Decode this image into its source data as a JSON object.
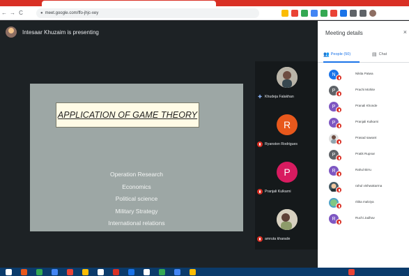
{
  "browser": {
    "url": "meet.google.com/ffo-jhjc-xey",
    "back": "←",
    "forward": "→",
    "reload": "C"
  },
  "meeting": {
    "presenter_text": "Intesaar Khuzaim is presenting"
  },
  "slide": {
    "title": "APPLICATION OF GAME THEORY",
    "items": [
      "Operation Research",
      "Economics",
      "Political science",
      "Military Strategy",
      "International relations"
    ],
    "background": "#9da7a5"
  },
  "tiles": [
    {
      "name": "Khudeja Falakhan",
      "type": "photo",
      "pinned": true
    },
    {
      "name": "Ryanston Rodrigues",
      "type": "letter",
      "letter": "R",
      "color": "#e8581c"
    },
    {
      "name": "Pranjali Kulkarni",
      "type": "letter",
      "letter": "P",
      "color": "#d81b60"
    },
    {
      "name": "amruta kharade",
      "type": "photo"
    }
  ],
  "panel": {
    "title": "Meeting details",
    "close": "×",
    "tab_people": "People (50)",
    "tab_chat": "Chat",
    "people": [
      {
        "name": "Nikita Patwa",
        "letter": "N",
        "color": "#1a73e8"
      },
      {
        "name": "Prachi Mohite",
        "letter": "P",
        "color": "#5f6368"
      },
      {
        "name": "Pranali Khonde",
        "letter": "P",
        "color": "#7e57c2"
      },
      {
        "name": "Pranjali Kulkarni",
        "letter": "P",
        "color": "#7e57c2"
      },
      {
        "name": "Prasad sawant",
        "letter": "",
        "color": "#e0e0e0"
      },
      {
        "name": "Pratik Rupnar",
        "letter": "P",
        "color": "#5f6368"
      },
      {
        "name": "Rahul Birru",
        "letter": "R",
        "color": "#7e57c2"
      },
      {
        "name": "rahul vishwakarma",
        "letter": "",
        "color": "#455a64"
      },
      {
        "name": "ritika malviya",
        "letter": "",
        "color": "#4fa3c7"
      },
      {
        "name": "Ruchi Jadhav",
        "letter": "R",
        "color": "#7e57c2"
      }
    ]
  },
  "colors": {
    "accent": "#1a73e8",
    "mic_off": "#d93025",
    "stage_bg": "#1d2225"
  }
}
